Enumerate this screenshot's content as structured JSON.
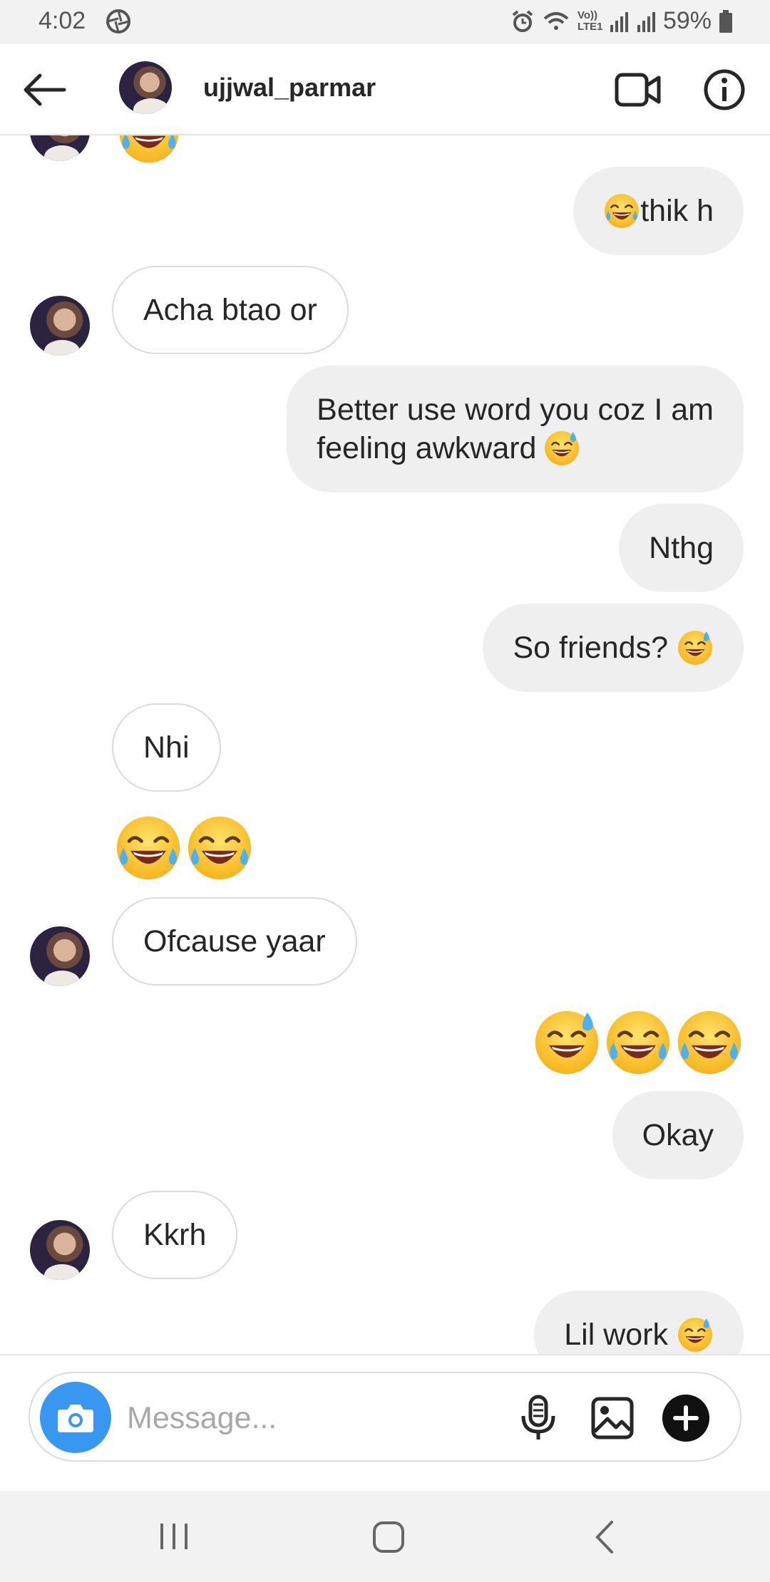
{
  "status_bar": {
    "time": "4:02",
    "battery": "59%",
    "network_label": "Vo)) LTE1"
  },
  "header": {
    "username": "ujjwal_parmar"
  },
  "messages": [
    {
      "dir": "out",
      "text": "thik h",
      "emoji_before": "joy"
    },
    {
      "dir": "in",
      "text": "Acha btao or"
    },
    {
      "dir": "out",
      "lines": [
        "Better use word you coz I am",
        "feeling awkward"
      ],
      "emoji_after": "sweat-smile"
    },
    {
      "dir": "out",
      "text": "Nthg"
    },
    {
      "dir": "out",
      "text": "So friends?",
      "emoji_after": "sweat-smile"
    },
    {
      "dir": "in",
      "text": "Nhi"
    },
    {
      "dir": "in",
      "emoji_only": [
        "joy",
        "joy"
      ]
    },
    {
      "dir": "in",
      "text": "Ofcause yaar"
    },
    {
      "dir": "out",
      "emoji_only": [
        "sweat-smile",
        "joy",
        "joy"
      ]
    },
    {
      "dir": "out",
      "text": "Okay"
    },
    {
      "dir": "in",
      "text": "Kkrh"
    },
    {
      "dir": "out",
      "text": "Lil work",
      "emoji_after": "sweat-smile"
    }
  ],
  "composer": {
    "placeholder": "Message..."
  },
  "colors": {
    "accent": "#3897f0",
    "outgoing_bubble": "#efefef",
    "incoming_border": "#dbdbdb"
  }
}
